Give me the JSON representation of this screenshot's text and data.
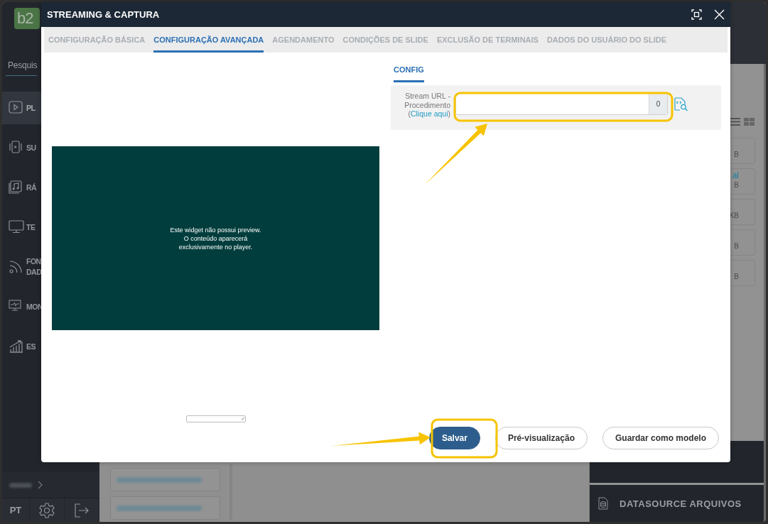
{
  "app": {
    "logo": "b2",
    "search_placeholder": "Pesquis",
    "nav": [
      {
        "lines": [
          "PL"
        ],
        "selected": true
      },
      {
        "lines": [
          "SU"
        ],
        "selected": false
      },
      {
        "lines": [
          "RÁ"
        ],
        "selected": false
      },
      {
        "lines": [
          "TE"
        ],
        "selected": false
      },
      {
        "lines": [
          "FON",
          "DAD"
        ],
        "selected": false
      },
      {
        "lines": [
          "MON"
        ],
        "selected": false
      },
      {
        "lines": [
          "ES"
        ],
        "selected": false
      }
    ],
    "language": "PT"
  },
  "right_panel": {
    "cards": [
      {
        "lines": [
          {
            "text": "B",
            "kind": "size"
          }
        ]
      },
      {
        "lines": [
          {
            "text": "al",
            "kind": "link"
          },
          {
            "text": "B",
            "kind": "size"
          }
        ]
      },
      {
        "lines": [
          {
            "text": "KB",
            "kind": "size"
          }
        ]
      },
      {
        "lines": [
          {
            "text": "B",
            "kind": "size"
          }
        ]
      },
      {
        "lines": [
          {
            "text": "B",
            "kind": "size"
          }
        ]
      }
    ],
    "section": "DATASOURCE ARQUIVOS"
  },
  "dialog": {
    "title": "STREAMING & CAPTURA",
    "tabs": [
      {
        "label": "CONFIGURAÇÃO BÁSICA",
        "selected": false
      },
      {
        "label": "CONFIGURAÇÃO AVANÇADA",
        "selected": true
      },
      {
        "label": "AGENDAMENTO",
        "selected": false
      },
      {
        "label": "CONDIÇÕES DE SLIDE",
        "selected": false
      },
      {
        "label": "EXCLUSÃO DE TERMINAIS",
        "selected": false
      },
      {
        "label": "DADOS DO USUÁRIO DO SLIDE",
        "selected": false
      }
    ],
    "preview": {
      "message": "Este widget não possui preview.\nO conteúdo aparecerá\nexclusivamente no player.",
      "size_field": true
    },
    "config": {
      "tab": "CONFIG",
      "label_before": "Stream URL - Procedimento (",
      "link": "Clique aqui",
      "label_after": ")",
      "counter": "0"
    },
    "buttons": [
      {
        "label": "Salvar",
        "kind": "primary"
      },
      {
        "label": "Pré-visualização",
        "kind": "outline"
      },
      {
        "label": "Guardar como modelo",
        "kind": "outline"
      }
    ]
  },
  "annotations": [
    {
      "kind": "frame"
    },
    {
      "kind": "arrow"
    },
    {
      "kind": "frame"
    },
    {
      "kind": "arrow"
    }
  ]
}
